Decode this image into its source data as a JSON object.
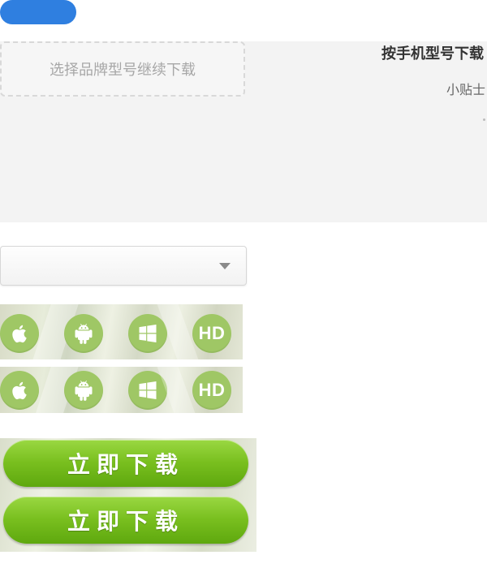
{
  "colors": {
    "primary_blue": "#2f7fe0",
    "green_icon": "#9fc765",
    "green_button_top": "#9ad842",
    "green_button_bottom": "#5ea80e"
  },
  "brand_picker": {
    "prompt": "选择品牌型号继续下载"
  },
  "side_panel": {
    "title": "按手机型号下载",
    "tip": "小贴士"
  },
  "select": {
    "value": ""
  },
  "platform_rows": [
    {
      "apple": "apple-icon",
      "android": "android-icon",
      "windows": "windows-icon",
      "hd": "HD"
    },
    {
      "apple": "apple-icon",
      "android": "android-icon",
      "windows": "windows-icon",
      "hd": "HD"
    }
  ],
  "download_buttons": [
    {
      "label": "立即下载"
    },
    {
      "label": "立即下载"
    }
  ]
}
